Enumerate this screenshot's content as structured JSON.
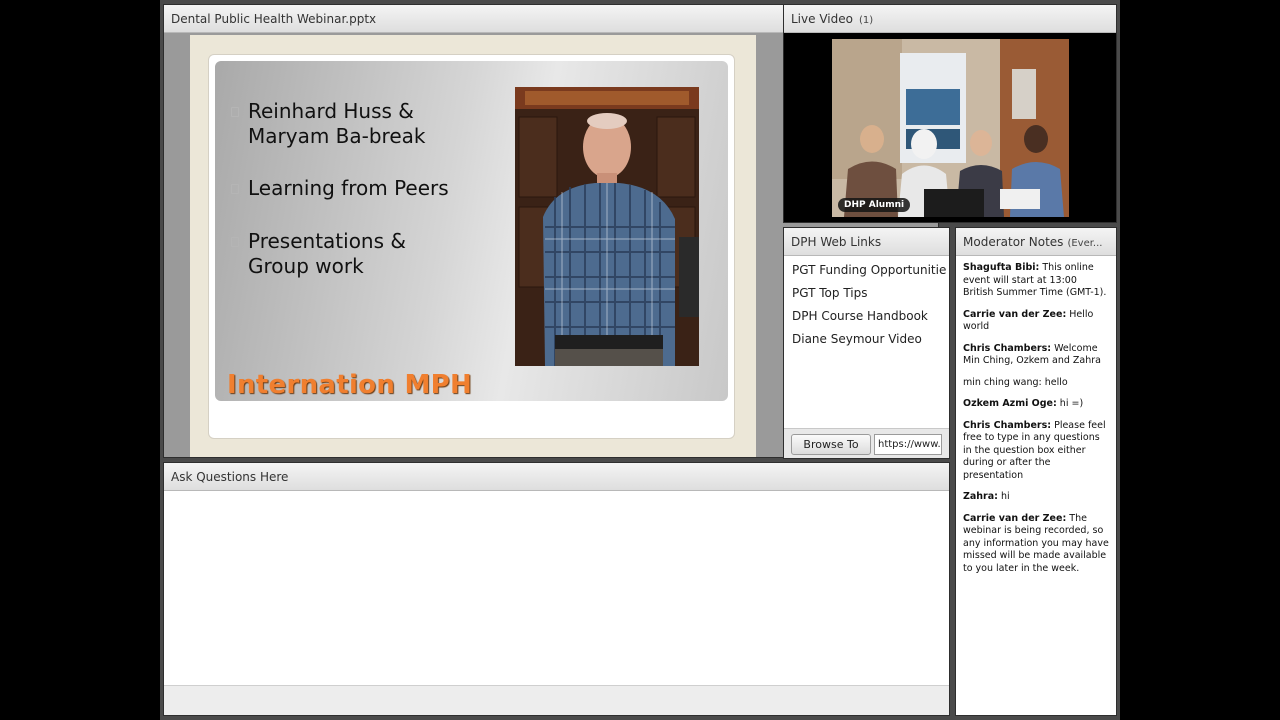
{
  "share": {
    "title": "Dental Public Health Webinar.pptx",
    "slide": {
      "bullets": [
        "Reinhard Huss &\nMaryam Ba-break",
        "Learning from Peers",
        "Presentations &\nGroup work"
      ],
      "title": "Internation MPH"
    }
  },
  "video": {
    "title": "Live Video",
    "count": "(1)",
    "camera_label": "DHP Alumni"
  },
  "links": {
    "title": "DPH Web Links",
    "items": [
      "PGT Funding Opportunitie",
      "PGT Top Tips",
      "DPH Course Handbook",
      "Diane Seymour Video"
    ],
    "browse_label": "Browse To",
    "url_value": "https://www."
  },
  "notes": {
    "title": "Moderator Notes",
    "scope": "(Ever...",
    "messages": [
      {
        "author": "Shagufta Bibi:",
        "text": " This online event will start at 13:00 British Summer Time (GMT-1)."
      },
      {
        "author": "Carrie van der Zee:",
        "text": " Hello world"
      },
      {
        "author": "Chris Chambers:",
        "text": " Welcome Min Ching, Ozkem and Zahra"
      },
      {
        "author": "",
        "text": "min ching wang: hello"
      },
      {
        "author": "Ozkem Azmi Oge:",
        "text": " hi =)"
      },
      {
        "author": "Chris Chambers:",
        "text": " Please feel free to type in any questions in the question box either during or after the presentation"
      },
      {
        "author": "Zahra:",
        "text": " hi"
      },
      {
        "author": "Carrie van der Zee:",
        "text": " The webinar is being recorded, so any information you may have missed will be made available to you later in the week."
      }
    ]
  },
  "questions": {
    "title": "Ask Questions Here"
  }
}
